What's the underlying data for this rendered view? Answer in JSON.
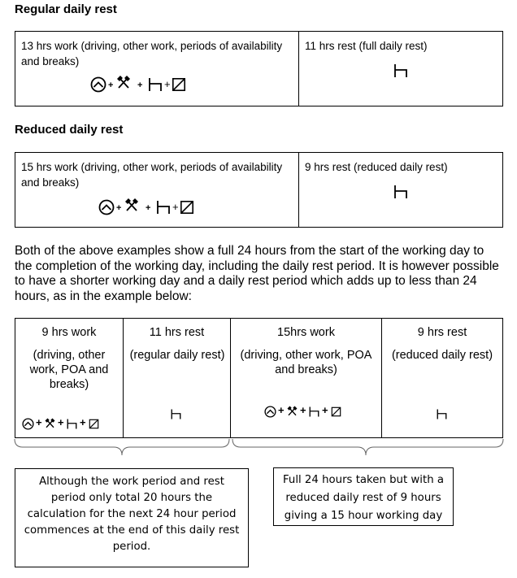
{
  "sections": {
    "regular": {
      "heading": "Regular daily rest",
      "work_text": "13 hrs work (driving, other work, periods of availability and breaks)",
      "rest_text": "11 hrs rest (full daily rest)",
      "work_icons": [
        "steering-wheel-icon",
        "crossed-hammers-icon",
        "bed-icon",
        "availability-box-icon"
      ],
      "rest_icon": "bed-icon"
    },
    "reduced": {
      "heading": "Reduced daily rest",
      "work_text": "15 hrs work (driving, other work, periods of availability and breaks)",
      "rest_text": "9 hrs rest (reduced daily rest)",
      "work_icons": [
        "steering-wheel-icon",
        "crossed-hammers-icon",
        "bed-icon",
        "availability-box-icon"
      ],
      "rest_icon": "bed-icon"
    }
  },
  "paragraph": "Both of the above examples show a full 24 hours from the start of the working day to the completion of the working day, including the daily rest period. It is however possible to have a shorter working day and a daily rest period which adds up to less than 24 hours, as in the example below:",
  "timeline": {
    "cells": [
      {
        "title": "9 hrs work",
        "detail": "(driving, other work, POA and breaks)",
        "icon": "work-icons"
      },
      {
        "title": "11 hrs rest",
        "detail": "(regular daily rest)",
        "icon": "bed-icon"
      },
      {
        "title": "15hrs work",
        "detail": "(driving, other work, POA and breaks)",
        "icon": "work-icons"
      },
      {
        "title": "9 hrs rest",
        "detail": "(reduced daily rest)",
        "icon": "bed-icon"
      }
    ],
    "plus": "+"
  },
  "notes": {
    "left": "Although the work period and rest period only total 20 hours the calculation for the next 24 hour period commences at the end of this daily rest period.",
    "right": "Full 24 hours taken but with a reduced daily rest of 9 hours giving a 15 hour working day"
  }
}
